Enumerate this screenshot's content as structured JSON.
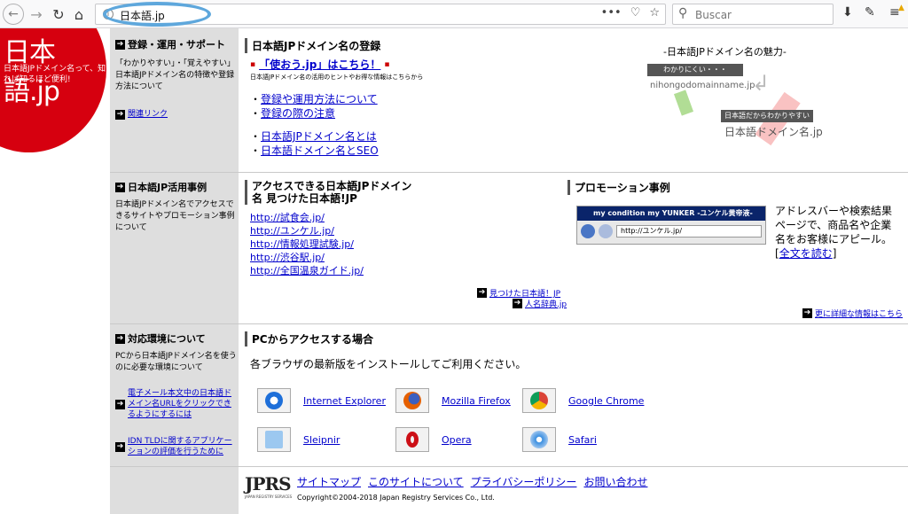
{
  "browser": {
    "url": "日本語.jp",
    "search_placeholder": "Buscar",
    "menu_dots": "•••"
  },
  "logo": {
    "title": "日本語.jp",
    "tagline": "日本語JPドメイン名って、知れば知るほど便利!"
  },
  "section1": {
    "side_title": "登録・運用・サポート",
    "side_desc": "「わかりやすい」・「覚えやすい」日本語JPドメイン名の特徴や登録方法について",
    "side_link": "関連リンク",
    "title": "日本語JPドメイン名の登録",
    "promo_link": "「使おう.jp」はこちら！",
    "promo_sub": "日本語JPドメイン名の活用のヒントやお得な情報はこちらから",
    "links": [
      "登録や運用方法について",
      "登録の際の注意"
    ],
    "links2": [
      "日本語JPドメイン名とは",
      "日本語ドメイン名とSEO"
    ],
    "charm_title": "-日本語JPドメイン名の魅力-",
    "charm_hard": "わかりにくい・・・",
    "charm_ascii": "nihongodomainname.jp",
    "charm_easy": "日本語だからわかりやすい",
    "charm_jp": "日本語ドメイン名.jp"
  },
  "section2": {
    "side_title": "日本語JP活用事例",
    "side_desc": "日本語JPドメイン名でアクセスできるサイトやプロモーション事例について",
    "title": "アクセスできる日本語JPドメイン名 見つけた日本語!JP",
    "sites": [
      "http://試食会.jp/",
      "http://ユンケル.jp/",
      "http://情報処理試験.jp/",
      "http://渋谷駅.jp/",
      "http://全国温泉ガイド.jp/"
    ],
    "found_link": "見つけた日本語！JP",
    "dict_link": "人名辞典.jp",
    "promo_title": "プロモーション事例",
    "promo_window_title": "my condition my YUNKER -ユンケル黄帝液-",
    "promo_window_url": "http://ユンケル.jp/",
    "promo_text": "アドレスバーや検索結果ページで、商品名や企業名をお客様にアピール。",
    "promo_link": "全文を読む",
    "more_link": "更に詳細な情報はこちら"
  },
  "section3": {
    "side_title": "対応環境について",
    "side_desc": "PCから日本語JPドメイン名を使うのに必要な環境について",
    "side_link1": "電子メール本文中の日本語ドメイン名URLをクリックできるようにするには",
    "side_link2": "IDN TLDに関するアプリケーションの評価を行うために",
    "title": "PCからアクセスする場合",
    "desc": "各ブラウザの最新版をインストールしてご利用ください。",
    "browsers": [
      "Internet Explorer",
      "Mozilla Firefox",
      "Google Chrome",
      "Sleipnir",
      "Opera",
      "Safari"
    ]
  },
  "footer": {
    "logo": "JPRS",
    "logo_sub": "JAPAN REGISTRY SERVICES",
    "links": [
      "サイトマップ",
      "このサイトについて",
      "プライバシーポリシー",
      "お問い合わせ"
    ],
    "copyright": "Copyright©2004-2018 Japan Registry Services Co., Ltd."
  }
}
